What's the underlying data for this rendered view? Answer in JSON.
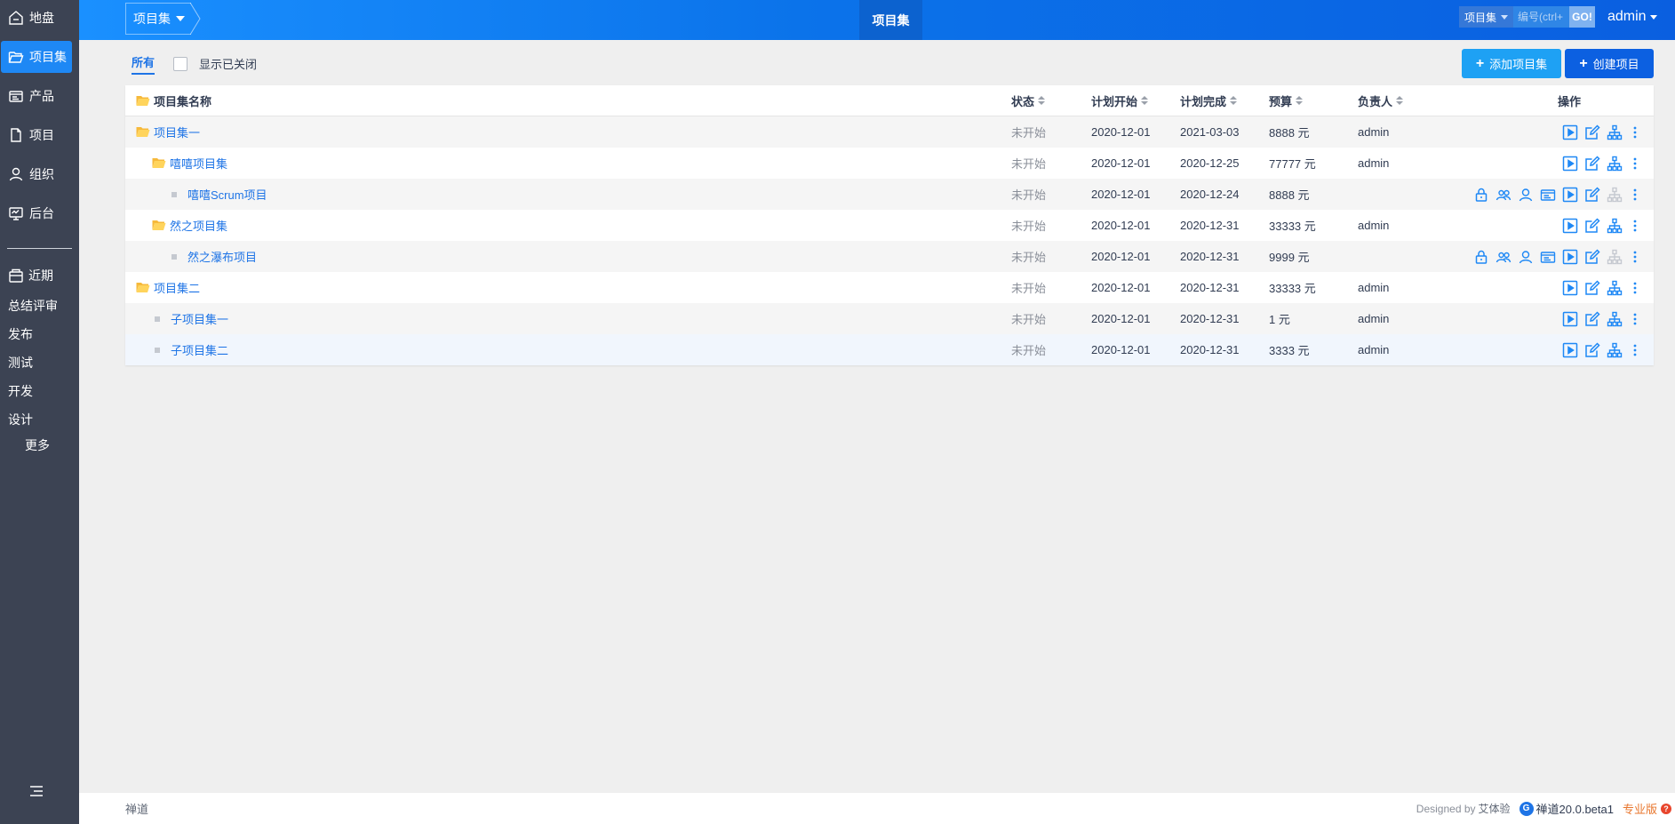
{
  "sidebar": {
    "items": [
      {
        "label": "地盘",
        "icon": "home-icon",
        "active": false
      },
      {
        "label": "项目集",
        "icon": "folder-open-icon",
        "active": true
      },
      {
        "label": "产品",
        "icon": "product-icon",
        "active": false
      },
      {
        "label": "项目",
        "icon": "file-icon",
        "active": false
      },
      {
        "label": "组织",
        "icon": "user-icon",
        "active": false
      },
      {
        "label": "后台",
        "icon": "monitor-icon",
        "active": false
      }
    ],
    "recent_label": "近期",
    "recent_items": [
      "总结评审",
      "发布",
      "测试",
      "开发",
      "设计"
    ],
    "more_label": "更多"
  },
  "header": {
    "breadcrumb": "项目集",
    "active_tab": "项目集",
    "search_type": "项目集",
    "search_placeholder": "编号(ctrl+",
    "search_go": "GO!",
    "user": "admin"
  },
  "toolbar": {
    "filter_all": "所有",
    "show_closed": "显示已关闭",
    "add_program": "添加项目集",
    "create_project": "创建项目"
  },
  "table": {
    "headers": {
      "name": "项目集名称",
      "status": "状态",
      "start": "计划开始",
      "end": "计划完成",
      "budget": "预算",
      "owner": "负责人",
      "actions": "操作"
    },
    "rows": [
      {
        "name": "项目集一",
        "kind": "program",
        "level": 0,
        "status": "未开始",
        "start": "2020-12-01",
        "end": "2021-03-03",
        "budget": "8888 元",
        "owner": "admin"
      },
      {
        "name": "嘻嘻项目集",
        "kind": "program",
        "level": 1,
        "status": "未开始",
        "start": "2020-12-01",
        "end": "2020-12-25",
        "budget": "77777 元",
        "owner": "admin"
      },
      {
        "name": "嘻嘻Scrum项目",
        "kind": "project",
        "level": 2,
        "status": "未开始",
        "start": "2020-12-01",
        "end": "2020-12-24",
        "budget": "8888 元",
        "owner": ""
      },
      {
        "name": "然之项目集",
        "kind": "program",
        "level": 1,
        "status": "未开始",
        "start": "2020-12-01",
        "end": "2020-12-31",
        "budget": "33333 元",
        "owner": "admin"
      },
      {
        "name": "然之瀑布项目",
        "kind": "project",
        "level": 2,
        "status": "未开始",
        "start": "2020-12-01",
        "end": "2020-12-31",
        "budget": "9999 元",
        "owner": ""
      },
      {
        "name": "项目集二",
        "kind": "program",
        "level": 0,
        "status": "未开始",
        "start": "2020-12-01",
        "end": "2020-12-31",
        "budget": "33333 元",
        "owner": "admin"
      },
      {
        "name": "子项目集一",
        "kind": "subprogram",
        "level": 1,
        "status": "未开始",
        "start": "2020-12-01",
        "end": "2020-12-31",
        "budget": "1 元",
        "owner": "admin"
      },
      {
        "name": "子项目集二",
        "kind": "subprogram",
        "level": 1,
        "status": "未开始",
        "start": "2020-12-01",
        "end": "2020-12-31",
        "budget": "3333 元",
        "owner": "admin"
      }
    ]
  },
  "footer": {
    "brand": "禅道",
    "designed_by": "Designed by",
    "company": "艾体验",
    "logo_char": "G",
    "version": "禅道20.0.beta1",
    "edition": "专业版",
    "help_char": "?"
  },
  "colors": {
    "accent": "#1e74e6",
    "sidebar_bg": "#3c4353",
    "folder": "#ffc53d",
    "action_icon": "#1e88f5",
    "disabled_icon": "#c5c9d0"
  }
}
